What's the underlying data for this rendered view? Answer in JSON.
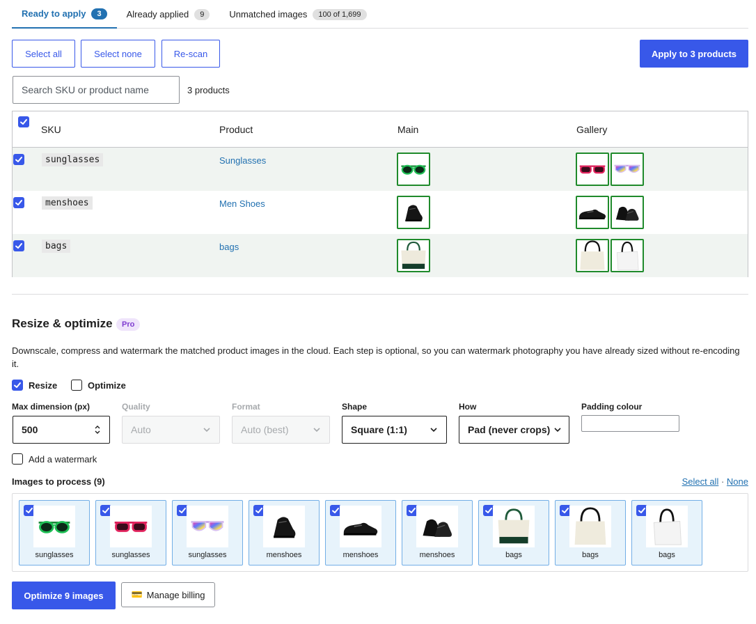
{
  "tabs": [
    {
      "label": "Ready to apply",
      "count": "3"
    },
    {
      "label": "Already applied",
      "count": "9"
    },
    {
      "label": "Unmatched images",
      "count": "100 of 1,699"
    }
  ],
  "toolbar": {
    "select_all": "Select all",
    "select_none": "Select none",
    "rescan": "Re-scan",
    "apply": "Apply to 3 products"
  },
  "search": {
    "placeholder": "Search SKU or product name",
    "value": ""
  },
  "products_count": "3 products",
  "table": {
    "headers": [
      "SKU",
      "Product",
      "Main",
      "Gallery"
    ],
    "rows": [
      {
        "sku": "sunglasses",
        "product": "Sunglasses",
        "main": "sunglasses-green",
        "gallery": [
          "sunglasses-pink",
          "sunglasses-rainbow"
        ]
      },
      {
        "sku": "menshoes",
        "product": "Men Shoes",
        "main": "shoe-angle",
        "gallery": [
          "shoe-side",
          "shoe-pair"
        ]
      },
      {
        "sku": "bags",
        "product": "bags",
        "main": "tote-green",
        "gallery": [
          "tote-cream",
          "tote-white"
        ]
      }
    ]
  },
  "resize": {
    "title": "Resize & optimize",
    "badge": "Pro",
    "description": "Downscale, compress and watermark the matched product images in the cloud. Each step is optional, so you can watermark photography you have already sized without re-encoding it.",
    "resize_label": "Resize",
    "resize_checked": true,
    "optimize_label": "Optimize",
    "optimize_checked": false,
    "fields": {
      "max_dimension_label": "Max dimension (px)",
      "max_dimension_value": "500",
      "quality_label": "Quality",
      "quality_value": "Auto",
      "format_label": "Format",
      "format_value": "Auto (best)",
      "shape_label": "Shape",
      "shape_value": "Square (1:1)",
      "how_label": "How",
      "how_value": "Pad (never crops)",
      "padding_label": "Padding colour",
      "padding_value": ""
    },
    "watermark_label": "Add a watermark",
    "watermark_checked": false
  },
  "process": {
    "label": "Images to process (9)",
    "select_all": "Select all",
    "separator": "·",
    "none": "None",
    "images": [
      {
        "label": "sunglasses",
        "icon": "sunglasses-green"
      },
      {
        "label": "sunglasses",
        "icon": "sunglasses-pink"
      },
      {
        "label": "sunglasses",
        "icon": "sunglasses-rainbow"
      },
      {
        "label": "menshoes",
        "icon": "shoe-angle"
      },
      {
        "label": "menshoes",
        "icon": "shoe-side"
      },
      {
        "label": "menshoes",
        "icon": "shoe-pair"
      },
      {
        "label": "bags",
        "icon": "tote-green"
      },
      {
        "label": "bags",
        "icon": "tote-cream"
      },
      {
        "label": "bags",
        "icon": "tote-white"
      }
    ]
  },
  "actions": {
    "optimize": "Optimize 9 images",
    "billing_icon": "💳",
    "billing": "Manage billing"
  },
  "colors": {
    "accent": "#3858e9",
    "link": "#2271b1",
    "match_border": "#1f8a2b",
    "pro_badge": "#7e3bd0"
  }
}
